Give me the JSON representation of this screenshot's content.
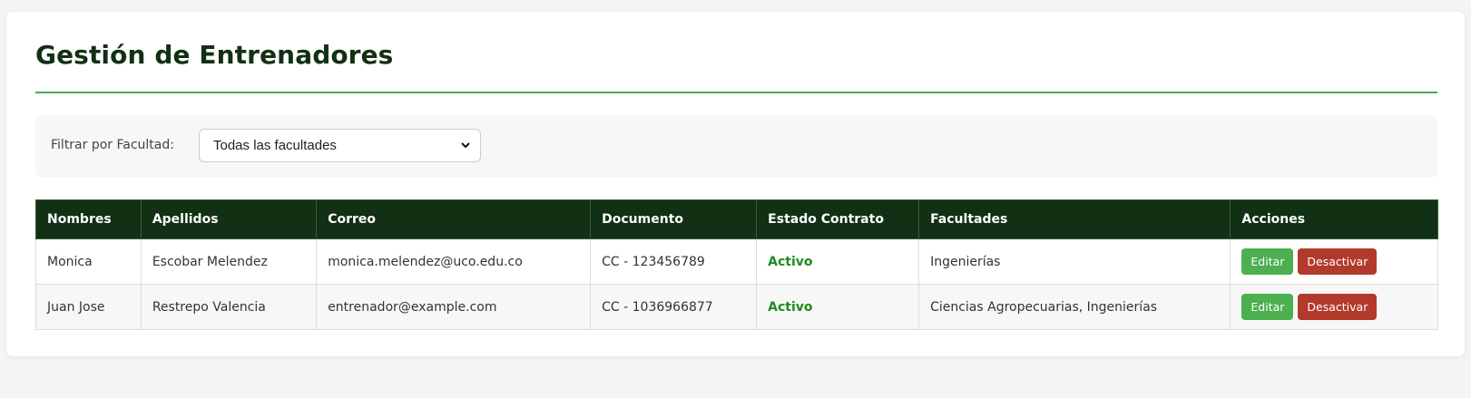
{
  "header": {
    "title": "Gestión de Entrenadores"
  },
  "filter": {
    "label": "Filtrar por Facultad:",
    "selected": "Todas las facultades"
  },
  "table": {
    "columns": [
      "Nombres",
      "Apellidos",
      "Correo",
      "Documento",
      "Estado Contrato",
      "Facultades",
      "Acciones"
    ],
    "rows": [
      {
        "nombres": "Monica",
        "apellidos": "Escobar Melendez",
        "correo": "monica.melendez@uco.edu.co",
        "documento": "CC - 123456789",
        "estado": "Activo",
        "facultades": "Ingenierías",
        "edit_label": "Editar",
        "deactivate_label": "Desactivar"
      },
      {
        "nombres": "Juan Jose",
        "apellidos": "Restrepo Valencia",
        "correo": "entrenador@example.com",
        "documento": "CC - 1036966877",
        "estado": "Activo",
        "facultades": "Ciencias Agropecuarias, Ingenierías",
        "edit_label": "Editar",
        "deactivate_label": "Desactivar"
      }
    ]
  },
  "colors": {
    "title": "#123014",
    "accent_rule": "#4caf50",
    "header_bg": "#123014",
    "status_active": "#1f8a1f",
    "edit_button": "#4caf50",
    "deactivate_button": "#b23a2b"
  },
  "icons": {
    "select_chevron": "chevron-down-icon"
  }
}
